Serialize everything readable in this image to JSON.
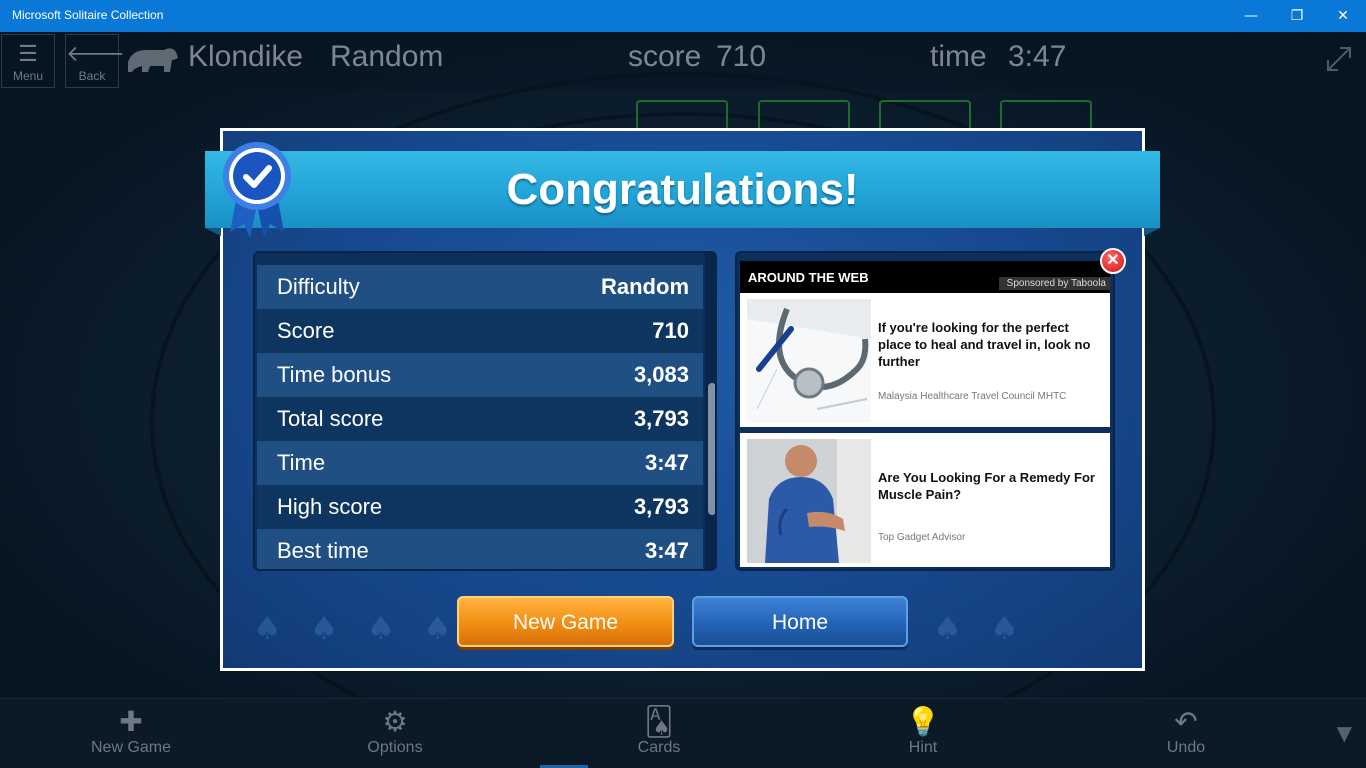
{
  "window": {
    "title": "Microsoft Solitaire Collection",
    "minimize_glyph": "—",
    "restore_glyph": "❐",
    "close_glyph": "✕"
  },
  "header": {
    "menu_label": "Menu",
    "back_label": "Back",
    "game_name": "Klondike",
    "difficulty": "Random",
    "score_label": "score",
    "score_value": "710",
    "time_label": "time",
    "time_value": "3:47"
  },
  "dialog": {
    "title": "Congratulations!",
    "stats": [
      {
        "label": "Difficulty",
        "value": "Random"
      },
      {
        "label": "Score",
        "value": "710"
      },
      {
        "label": "Time bonus",
        "value": "3,083"
      },
      {
        "label": "Total score",
        "value": "3,793"
      },
      {
        "label": "Time",
        "value": "3:47"
      },
      {
        "label": "High score",
        "value": "3,793"
      },
      {
        "label": "Best time",
        "value": "3:47"
      }
    ],
    "new_game_label": "New Game",
    "home_label": "Home"
  },
  "ad": {
    "heading": "AROUND THE WEB",
    "sponsor": "Sponsored by Taboola",
    "items": [
      {
        "headline": "If you're looking for the perfect place to heal and travel in, look no further",
        "source": "Malaysia Healthcare Travel Council  MHTC"
      },
      {
        "headline": "Are You Looking For a Remedy For Muscle Pain?",
        "source": "Top Gadget Advisor"
      }
    ]
  },
  "bottom_bar": {
    "new_game": "New Game",
    "options": "Options",
    "cards": "Cards",
    "hint": "Hint",
    "undo": "Undo"
  },
  "colors": {
    "titlebar": "#0a78d7",
    "dialog_blue": "#17498f",
    "banner": "#21a2d6",
    "new_game_orange": "#f08a10",
    "home_blue": "#2261b3"
  }
}
